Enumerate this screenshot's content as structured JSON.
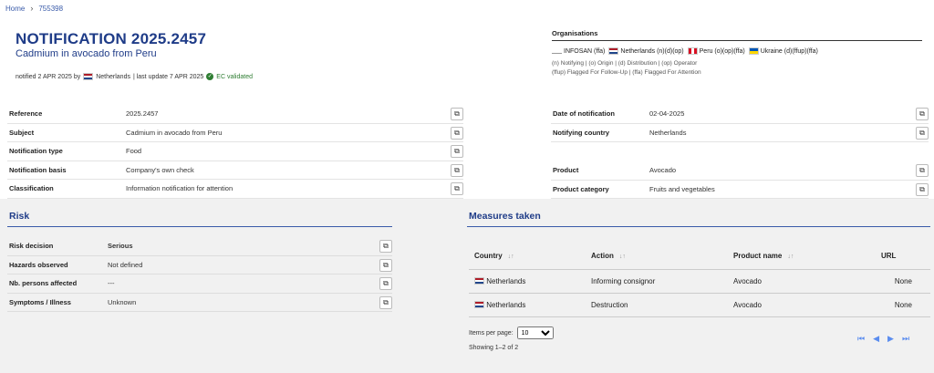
{
  "breadcrumb": {
    "home": "Home",
    "id": "755398"
  },
  "header": {
    "title": "NOTIFICATION 2025.2457",
    "subtitle": "Cadmium in avocado from Peru",
    "notified_prefix": "notified 2 APR 2025 by",
    "notified_country": "Netherlands",
    "last_update": "| last update 7 APR 2025",
    "validated": "EC validated"
  },
  "organisations": {
    "title": "Organisations",
    "items": [
      {
        "label": "INFOSAN (ffa)",
        "flag": "none"
      },
      {
        "label": "Netherlands (n)(d)(op)",
        "flag": "nl"
      },
      {
        "label": "Peru (o)(op)(ffa)",
        "flag": "pe"
      },
      {
        "label": "Ukraine (d)(ffup)(ffa)",
        "flag": "ua"
      }
    ],
    "legend1": "(n) Notifying | (o) Origin | (d) Distribution | (op) Operator",
    "legend2": "(ffup) Flagged For Follow-Up | (ffa) Flagged For Attention"
  },
  "details_left": [
    {
      "key": "Reference",
      "value": "2025.2457"
    },
    {
      "key": "Subject",
      "value": "Cadmium in avocado from Peru"
    },
    {
      "key": "Notification type",
      "value": "Food"
    },
    {
      "key": "Notification basis",
      "value": "Company's own check"
    },
    {
      "key": "Classification",
      "value": "Information notification for attention"
    }
  ],
  "details_right_top": [
    {
      "key": "Date of notification",
      "value": "02-04-2025"
    },
    {
      "key": "Notifying country",
      "value": "Netherlands"
    }
  ],
  "details_right_bottom": [
    {
      "key": "Product",
      "value": "Avocado"
    },
    {
      "key": "Product category",
      "value": "Fruits and vegetables"
    }
  ],
  "risk": {
    "title": "Risk",
    "rows": [
      {
        "key": "Risk decision",
        "value": "Serious"
      },
      {
        "key": "Hazards observed",
        "value": "Not defined"
      },
      {
        "key": "Nb. persons affected",
        "value": "---"
      },
      {
        "key": "Symptoms / Illness",
        "value": "Unknown"
      }
    ]
  },
  "measures": {
    "title": "Measures taken",
    "columns": [
      "Country",
      "Action",
      "Product name",
      "URL"
    ],
    "rows": [
      {
        "country": "Netherlands",
        "action": "Informing consignor",
        "product": "Avocado",
        "url": "None"
      },
      {
        "country": "Netherlands",
        "action": "Destruction",
        "product": "Avocado",
        "url": "None"
      }
    ],
    "items_per_page_label": "Items per page:",
    "items_per_page": "10",
    "showing": "Showing 1–2 of 2"
  },
  "colors": {
    "accent": "#1f3c88",
    "serious": "#c62828",
    "validated": "#2e7d32"
  }
}
